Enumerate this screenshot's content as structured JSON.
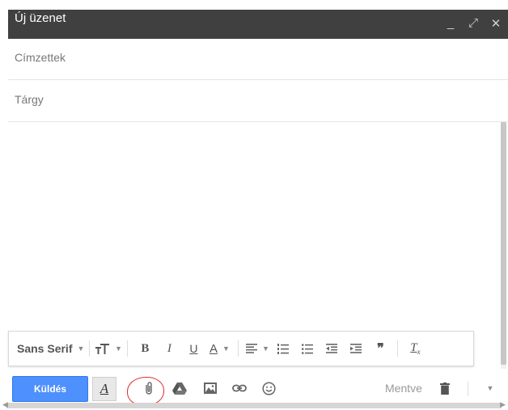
{
  "window": {
    "title": "Új üzenet",
    "controls": [
      "_",
      "⤢",
      "✕"
    ]
  },
  "fields": {
    "to_label": "Címzettek",
    "subject_label": "Tárgy"
  },
  "format_bar": {
    "font": "Sans Serif",
    "items": [
      "font-size",
      "bold",
      "italic",
      "underline",
      "text-color",
      "align",
      "numbered-list",
      "bulleted-list",
      "indent-less",
      "indent-more",
      "quote",
      "remove-formatting"
    ]
  },
  "bottom_bar": {
    "send_label": "Küldés",
    "status": "Mentve"
  }
}
